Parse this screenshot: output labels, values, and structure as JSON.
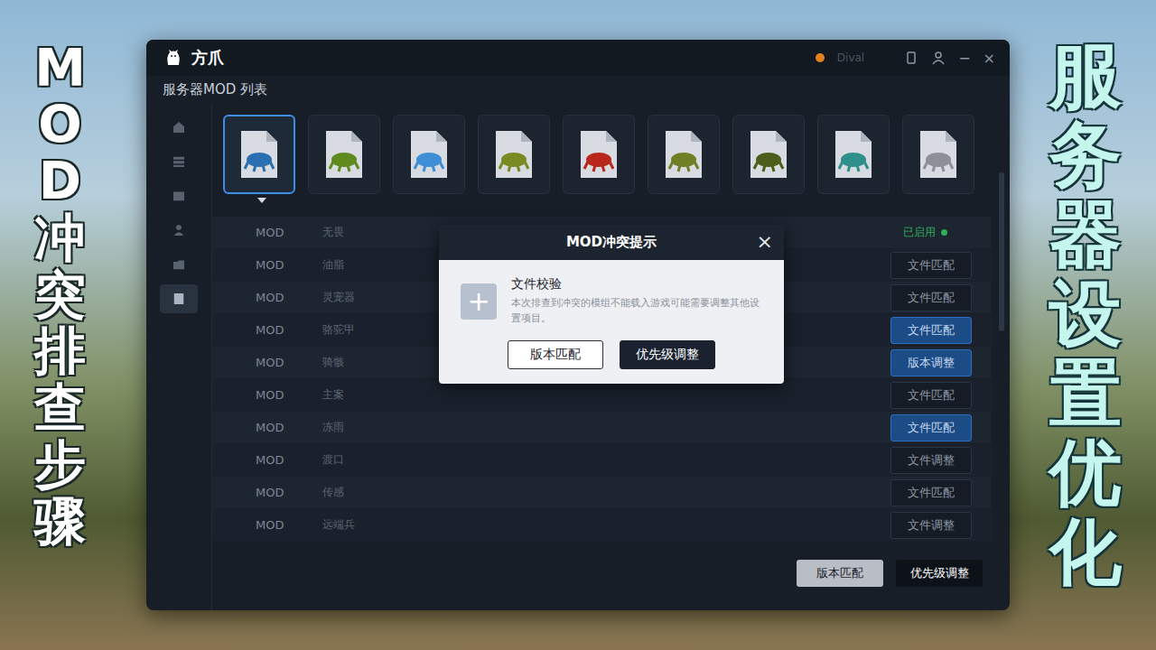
{
  "overlay": {
    "left_caption": "MOD冲突排查步骤",
    "right_caption": "服务器设置优化"
  },
  "window": {
    "title": "方爪",
    "account": "Dival",
    "controls": [
      "−",
      "×"
    ]
  },
  "page": {
    "title": "服务器MOD 列表"
  },
  "sidebar": {
    "items": [
      {
        "selected": false
      },
      {
        "selected": false
      },
      {
        "selected": false
      },
      {
        "selected": false
      },
      {
        "selected": false
      },
      {
        "selected": true
      }
    ]
  },
  "mods": [
    {
      "selected": true,
      "color": "#2a6fb0"
    },
    {
      "selected": false,
      "color": "#5e8a1e"
    },
    {
      "selected": false,
      "color": "#3f8fd6"
    },
    {
      "selected": false,
      "color": "#7a8a22"
    },
    {
      "selected": false,
      "color": "#b8261c"
    },
    {
      "selected": false,
      "color": "#6f7f25"
    },
    {
      "selected": false,
      "color": "#4d5e1c"
    },
    {
      "selected": false,
      "color": "#2f8f8a"
    },
    {
      "selected": false,
      "color": "#8d9097"
    }
  ],
  "table": {
    "rows": [
      {
        "type": "MOD",
        "name": "无畏",
        "kind": "status",
        "action": "已启用",
        "highlighted": false,
        "color": "#2fae5a"
      },
      {
        "type": "MOD",
        "name": "油脂",
        "kind": "button",
        "action": "文件匹配",
        "highlighted": false
      },
      {
        "type": "MOD",
        "name": "灵宠器",
        "kind": "button",
        "action": "文件匹配",
        "highlighted": false
      },
      {
        "type": "MOD",
        "name": "骆驼甲",
        "kind": "button",
        "action": "文件匹配",
        "highlighted": true
      },
      {
        "type": "MOD",
        "name": "骑骸",
        "kind": "button",
        "action": "版本调整",
        "highlighted": true
      },
      {
        "type": "MOD",
        "name": "主案",
        "kind": "button",
        "action": "文件匹配",
        "highlighted": false
      },
      {
        "type": "MOD",
        "name": "冻雨",
        "kind": "button",
        "action": "文件匹配",
        "highlighted": true
      },
      {
        "type": "MOD",
        "name": "渡口",
        "kind": "button",
        "action": "文件调整",
        "highlighted": false
      },
      {
        "type": "MOD",
        "name": "传感",
        "kind": "button",
        "action": "文件匹配",
        "highlighted": false
      },
      {
        "type": "MOD",
        "name": "远端兵",
        "kind": "button",
        "action": "文件调整",
        "highlighted": false
      }
    ]
  },
  "dialog": {
    "title": "MOD冲突提示",
    "close": "×",
    "icon": "+",
    "heading": "文件校验",
    "message": "本次排查到冲突的模组不能载入游戏可能需要调整其他设置项目。",
    "buttons": [
      {
        "label": "版本匹配",
        "primary": false
      },
      {
        "label": "优先级调整",
        "primary": true
      }
    ]
  },
  "footer": {
    "buttons": [
      {
        "label": "版本匹配",
        "primary": false
      },
      {
        "label": "优先级调整",
        "primary": true
      }
    ]
  }
}
